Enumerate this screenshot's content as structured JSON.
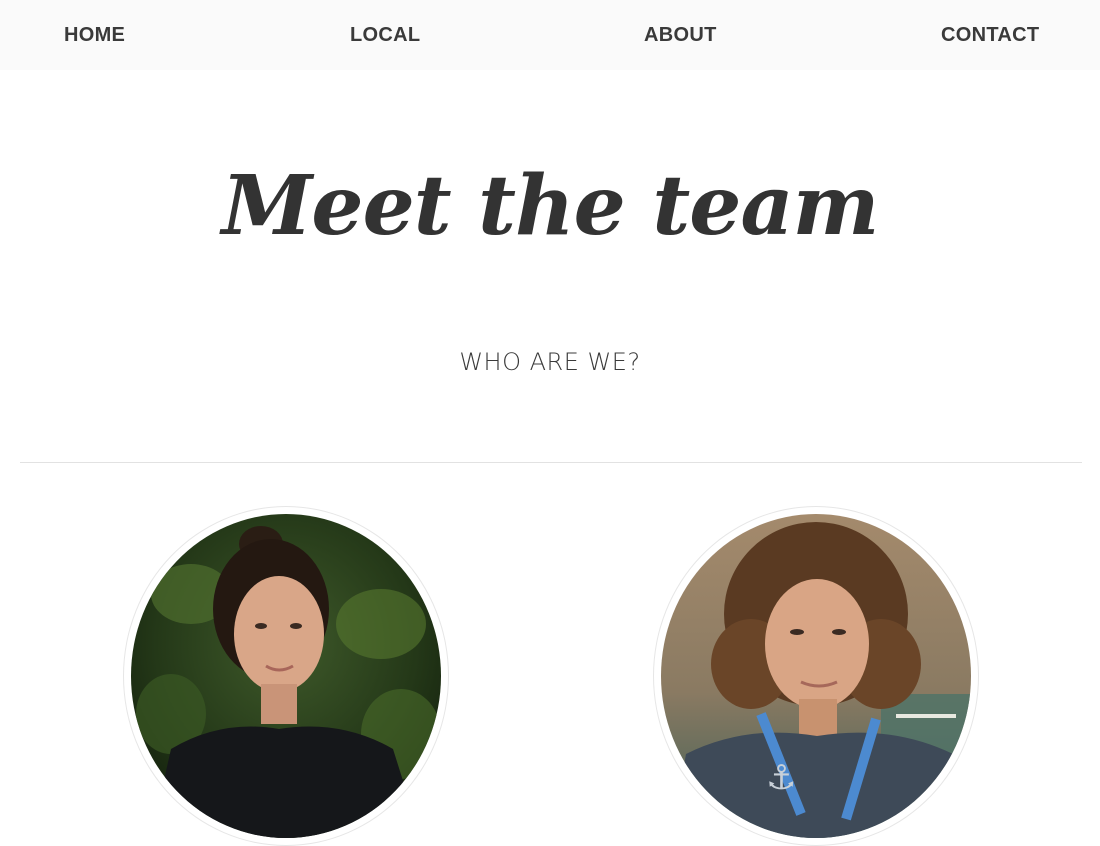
{
  "nav": {
    "items": [
      {
        "label": "HOME"
      },
      {
        "label": "LOCAL"
      },
      {
        "label": "ABOUT"
      },
      {
        "label": "CONTACT"
      }
    ]
  },
  "hero": {
    "title": "Meet the team",
    "subtitle": "WHO ARE WE?"
  },
  "team": {
    "members": [
      {
        "photo": "woman-portrait-photo"
      },
      {
        "photo": "man-portrait-photo"
      }
    ]
  }
}
